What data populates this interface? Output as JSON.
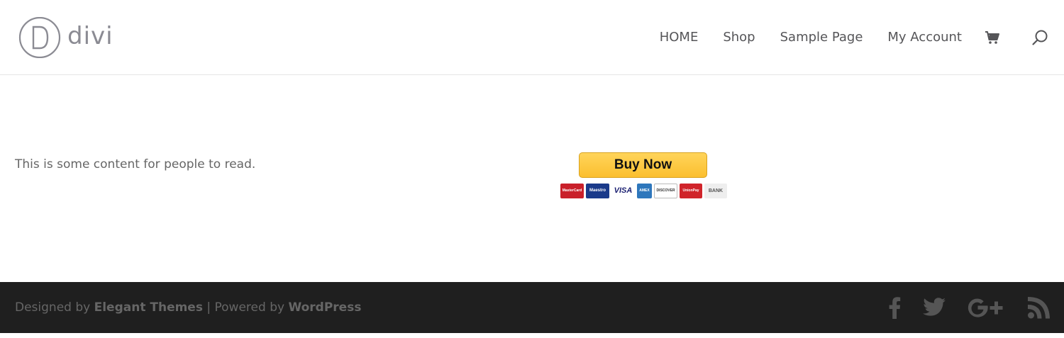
{
  "header": {
    "logo_text": "divi",
    "nav": [
      {
        "label": "HOME"
      },
      {
        "label": "Shop"
      },
      {
        "label": "Sample Page"
      },
      {
        "label": "My Account"
      }
    ],
    "icons": [
      "cart-icon",
      "search-icon"
    ]
  },
  "main": {
    "content_text": "This is some content for people to read.",
    "buy_button_label": "Buy Now",
    "payment_cards": [
      {
        "name": "mastercard",
        "label": "MasterCard",
        "bg": "#c9202a",
        "fg": "#ffffff"
      },
      {
        "name": "maestro",
        "label": "Maestro",
        "bg": "#1a3a8a",
        "fg": "#ffffff"
      },
      {
        "name": "visa",
        "label": "VISA",
        "bg": "#ffffff",
        "fg": "#1a1f71"
      },
      {
        "name": "amex",
        "label": "AMEX",
        "bg": "#2e77bc",
        "fg": "#ffffff"
      },
      {
        "name": "discover",
        "label": "DISCOVER",
        "bg": "#ffffff",
        "fg": "#333333"
      },
      {
        "name": "unionpay",
        "label": "UnionPay",
        "bg": "#d0242a",
        "fg": "#ffffff"
      },
      {
        "name": "bank",
        "label": "BANK",
        "bg": "#eeeeee",
        "fg": "#555555"
      }
    ]
  },
  "footer": {
    "designed_by": "Designed by",
    "designer": "Elegant Themes",
    "separator": "|",
    "powered_by": "Powered by",
    "platform": "WordPress",
    "social_icons": [
      "facebook-icon",
      "twitter-icon",
      "google-plus-icon",
      "rss-icon"
    ]
  },
  "colors": {
    "footer_bg": "#1f1f1f",
    "button_yellow": "#fbbf2f",
    "text_gray": "#666666"
  }
}
